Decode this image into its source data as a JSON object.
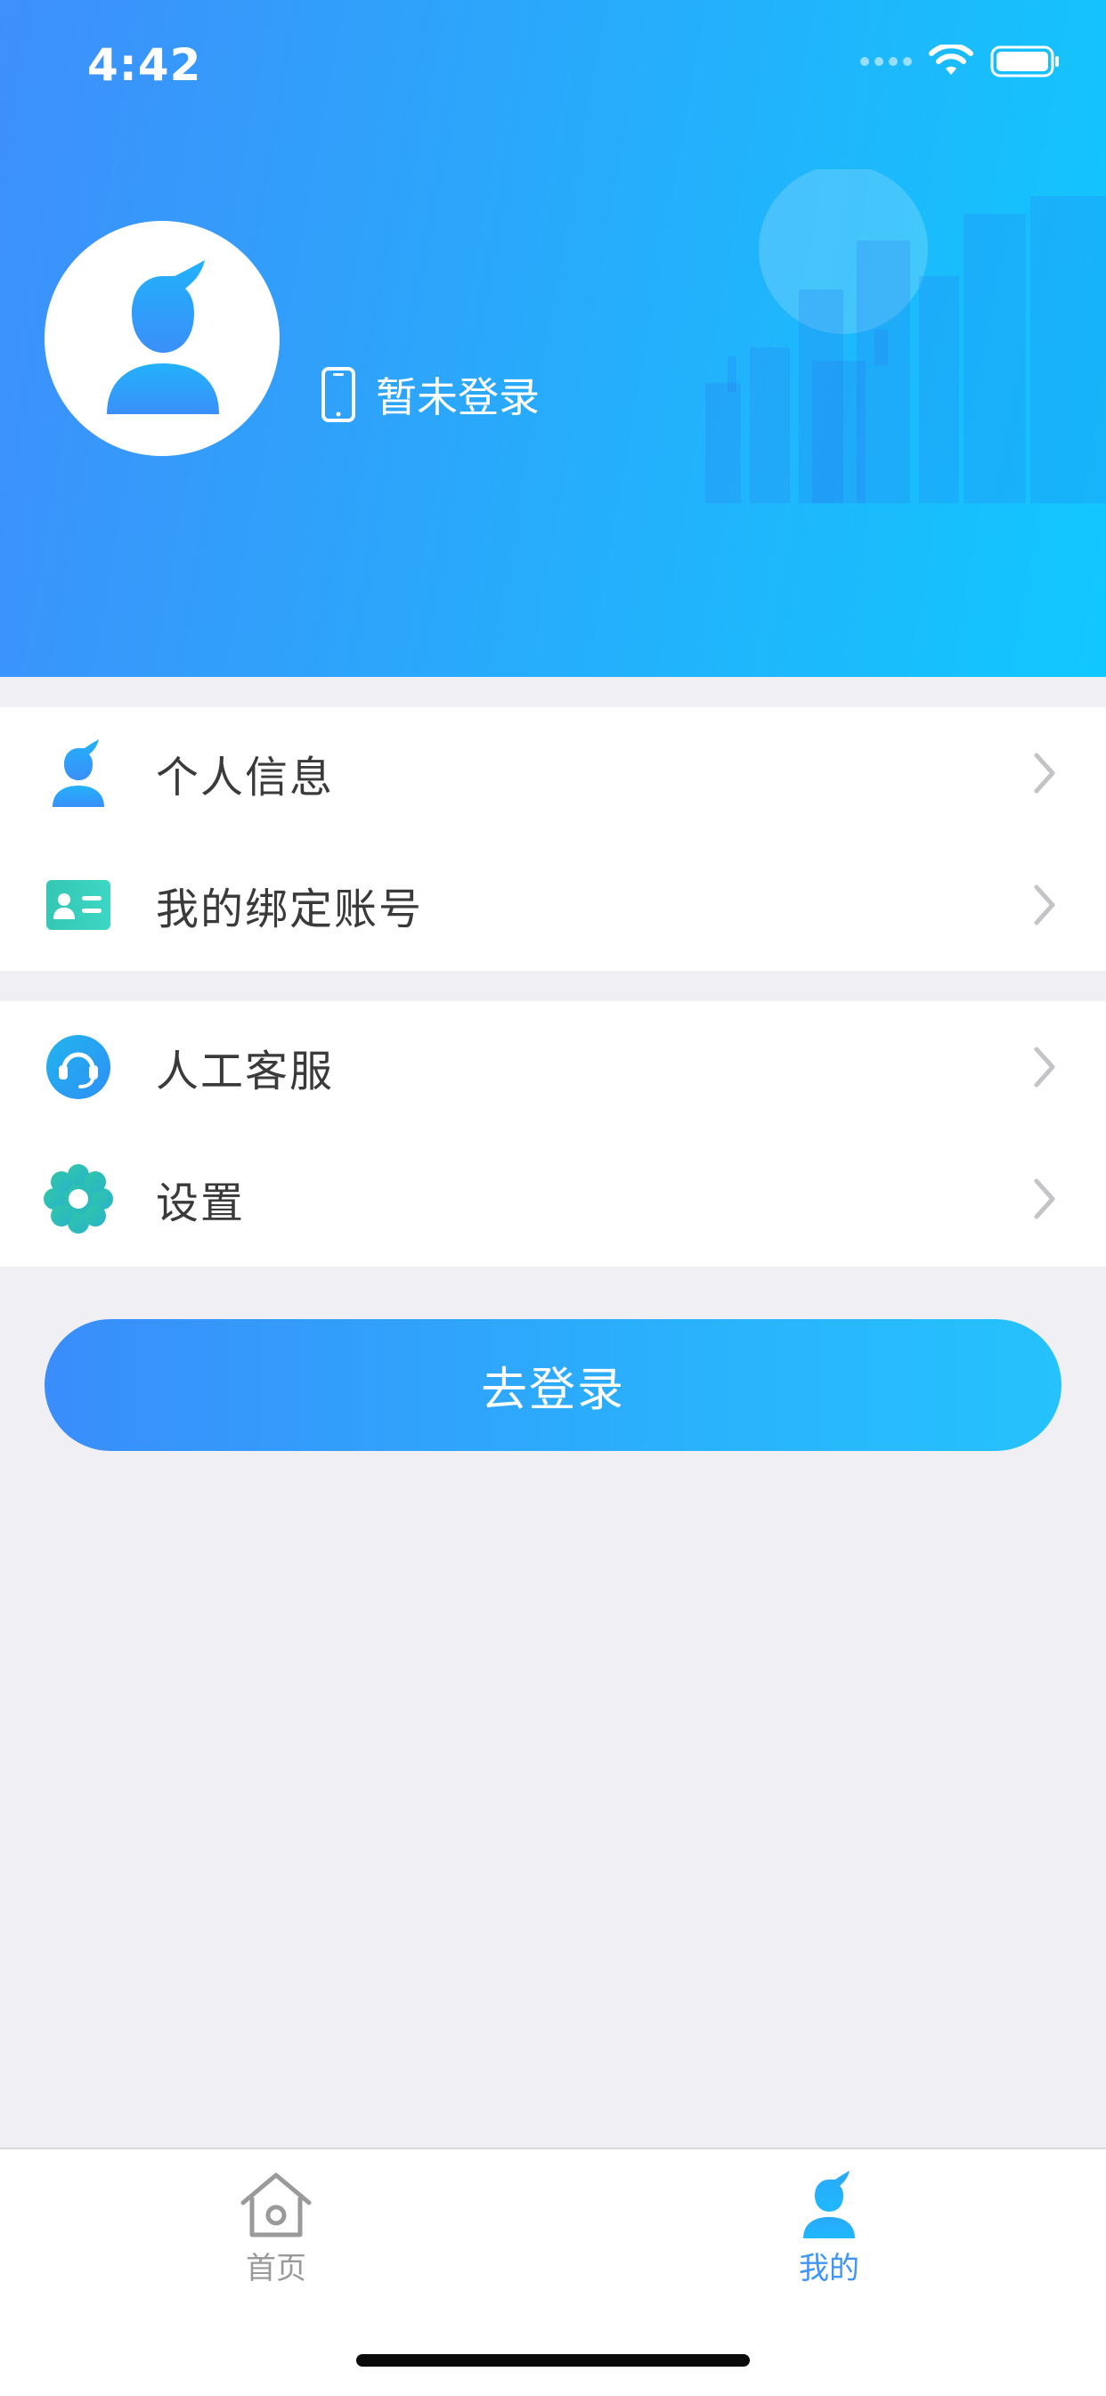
{
  "status_bar": {
    "time": "4:42"
  },
  "profile": {
    "login_status": "暂未登录"
  },
  "menu": {
    "group1": [
      {
        "label": "个人信息",
        "icon": "person-icon"
      },
      {
        "label": "我的绑定账号",
        "icon": "id-card-icon"
      }
    ],
    "group2": [
      {
        "label": "人工客服",
        "icon": "headset-icon"
      },
      {
        "label": "设置",
        "icon": "gear-icon"
      }
    ]
  },
  "login_button": {
    "label": "去登录"
  },
  "tabbar": {
    "home_label": "首页",
    "mine_label": "我的",
    "active": "mine"
  },
  "colors": {
    "header_gradient_start": "#3e8ffb",
    "header_gradient_end": "#10c8fd",
    "accent": "#3f95f8",
    "background": "#efeff4"
  }
}
